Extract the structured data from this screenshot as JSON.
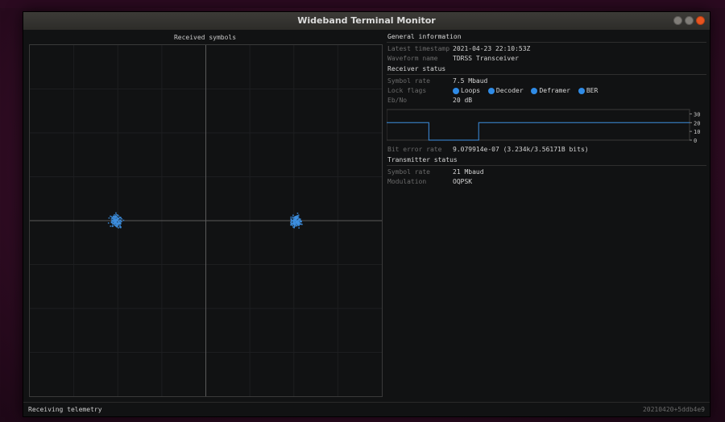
{
  "window": {
    "title": "Wideband Terminal Monitor"
  },
  "scope": {
    "title": "Received symbols"
  },
  "general": {
    "header": "General information",
    "rows": [
      {
        "label": "Latest timestamp",
        "value": "2021-04-23 22:10:53Z"
      },
      {
        "label": "Waveform name",
        "value": "TDRSS Transceiver"
      }
    ]
  },
  "receiver": {
    "header": "Receiver status",
    "symbol_rate": {
      "label": "Symbol rate",
      "value": "7.5 Mbaud"
    },
    "lock_flags": {
      "label": "Lock flags",
      "flags": [
        "Loops",
        "Decoder",
        "Deframer",
        "BER"
      ],
      "color": "#2f8be6"
    },
    "ebno": {
      "label": "Eb/No",
      "value": "20 dB"
    },
    "ber": {
      "label": "Bit error rate",
      "value": "9.079914e-07 (3.234k/3.56171B bits)"
    }
  },
  "ebno_chart": {
    "axis_ticks": [
      "30",
      "20",
      "10",
      "0"
    ],
    "ylim": [
      0,
      35
    ],
    "series_color": "#3d8fe0",
    "values": [
      20,
      20,
      20,
      20,
      20,
      20,
      20,
      20,
      20,
      20,
      20,
      0,
      0,
      0,
      0,
      0,
      0,
      0,
      0,
      0,
      0,
      0,
      0,
      0,
      20,
      20,
      20,
      20,
      20,
      20,
      20,
      20,
      20,
      20,
      20,
      20,
      20,
      20,
      20,
      20,
      20,
      20,
      20,
      20,
      20,
      20,
      20,
      20,
      20,
      20,
      20,
      20,
      20,
      20,
      20,
      20,
      20,
      20,
      20,
      20,
      20,
      20,
      20,
      20,
      20,
      20,
      20,
      20,
      20,
      20,
      20,
      20,
      20,
      20,
      20,
      20,
      20,
      20,
      20,
      20
    ]
  },
  "transmitter": {
    "header": "Transmitter status",
    "rows": [
      {
        "label": "Symbol rate",
        "value": "21 Mbaud"
      },
      {
        "label": "Modulation",
        "value": "OQPSK"
      }
    ]
  },
  "status": {
    "left": "Receiving telemetry",
    "right": "20210420+5ddb4e9"
  },
  "constellation": {
    "color": "#3d8fe0",
    "clusters": [
      {
        "i": -0.5,
        "q": 0.0
      },
      {
        "i": 0.5,
        "q": 0.0
      }
    ]
  }
}
